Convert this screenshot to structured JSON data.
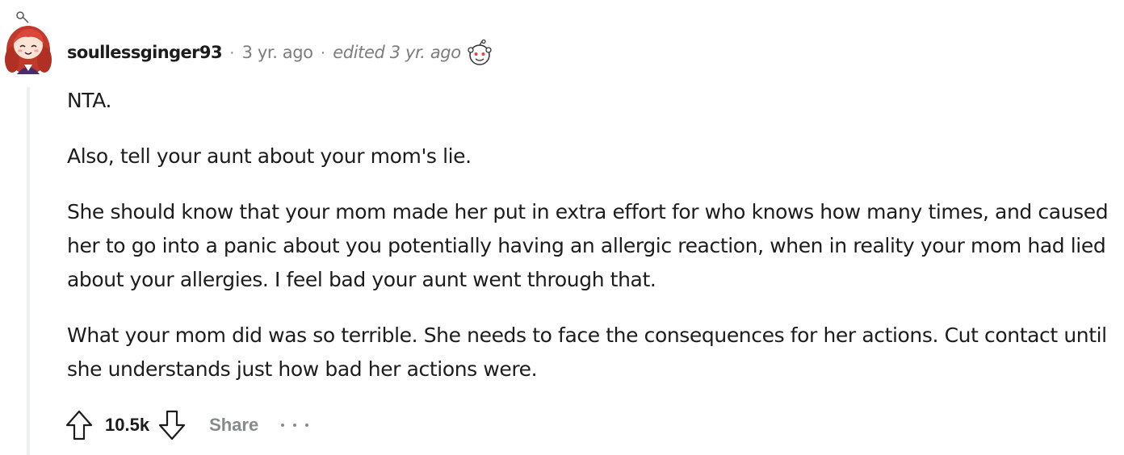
{
  "comment": {
    "author": "soullessginger93",
    "separator": "·",
    "timestamp": "3 yr. ago",
    "edited": "edited 3 yr. ago",
    "avatar_icon": "user-avatar-redhead",
    "award_icon": "snoo-icon",
    "paragraphs": [
      "NTA.",
      "Also, tell your aunt about your mom's lie.",
      "She should know that your mom made her put in extra effort for who knows how many times, and caused her to go into a panic about you potentially having an allergic reaction, when in reality your mom had lied about your allergies. I feel bad your aunt went through that.",
      "What your mom did was so terrible. She needs to face the consequences for her actions. Cut contact until she understands just how bad her actions were."
    ]
  },
  "actions": {
    "upvote_icon": "upvote-icon",
    "score": "10.5k",
    "downvote_icon": "downvote-icon",
    "share_label": "Share",
    "more_icon": "more-icon"
  },
  "colors": {
    "text": "#1c1c1c",
    "meta": "#7c7c7c",
    "action_muted": "#878a8c",
    "thread_line": "#edeff1"
  }
}
